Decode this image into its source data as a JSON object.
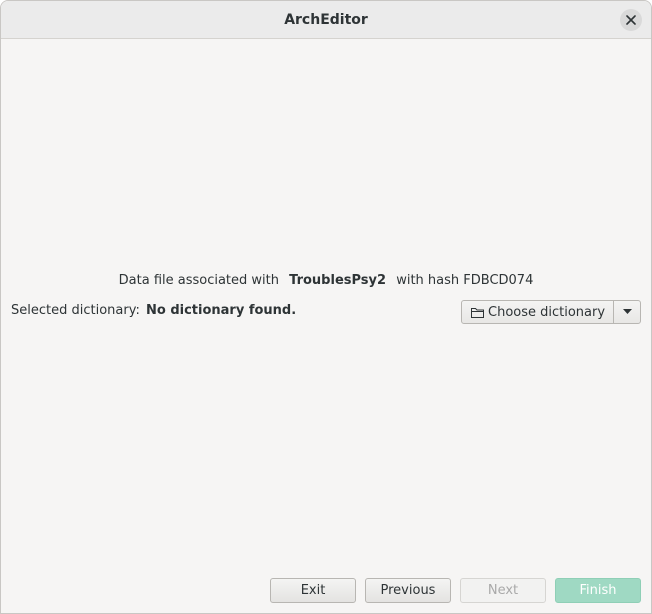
{
  "window": {
    "title": "ArchEditor"
  },
  "association": {
    "prefix": "Data file associated with",
    "name": "TroublesPsy2",
    "hash_text": "with hash FDBCD074"
  },
  "dictionary": {
    "label": "Selected dictionary:",
    "value": "No dictionary found.",
    "choose_label": "Choose dictionary"
  },
  "buttons": {
    "exit": "Exit",
    "previous": "Previous",
    "next": "Next",
    "finish": "Finish"
  },
  "icons": {
    "close": "close-icon",
    "folder": "folder-icon",
    "dropdown": "chevron-down-icon"
  }
}
